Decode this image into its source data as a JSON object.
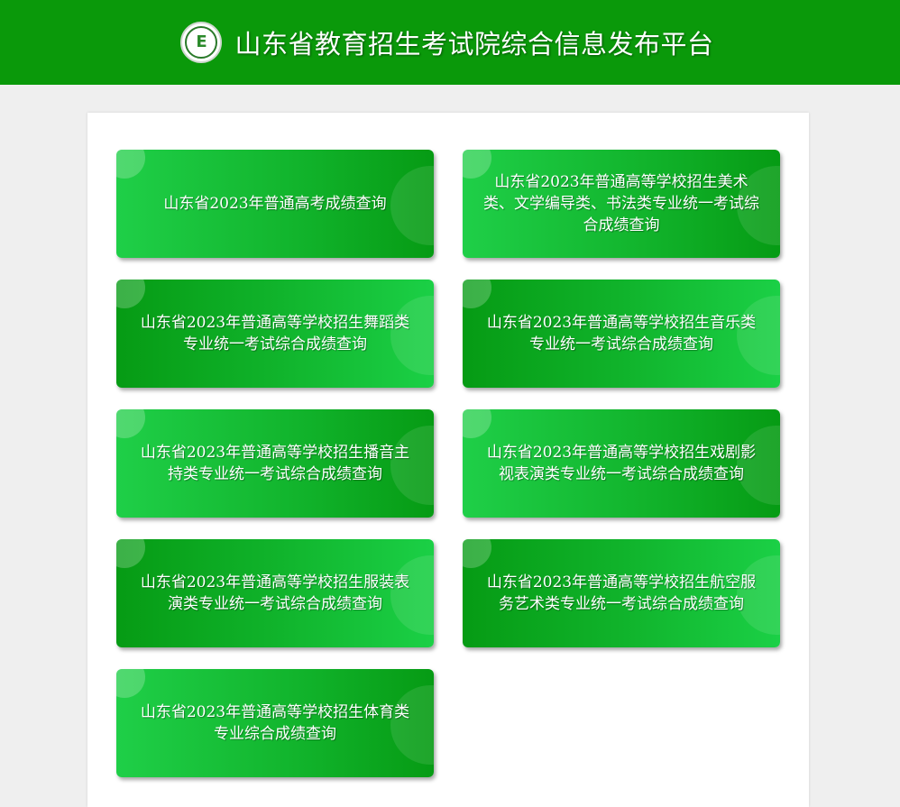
{
  "header": {
    "title": "山东省教育招生考试院综合信息发布平台",
    "logo_icon": "school-emblem-icon",
    "background_color": "#0a990a"
  },
  "cards": [
    {
      "label": "山东省2023年普通高考成绩查询"
    },
    {
      "label": "山东省2023年普通高等学校招生美术类、文学编导类、书法类专业统一考试综合成绩查询"
    },
    {
      "label": "山东省2023年普通高等学校招生舞蹈类专业统一考试综合成绩查询"
    },
    {
      "label": "山东省2023年普通高等学校招生音乐类专业统一考试综合成绩查询"
    },
    {
      "label": "山东省2023年普通高等学校招生播音主持类专业统一考试综合成绩查询"
    },
    {
      "label": "山东省2023年普通高等学校招生戏剧影视表演类专业统一考试综合成绩查询"
    },
    {
      "label": "山东省2023年普通高等学校招生服装表演类专业统一考试综合成绩查询"
    },
    {
      "label": "山东省2023年普通高等学校招生航空服务艺术类专业统一考试综合成绩查询"
    },
    {
      "label": "山东省2023年普通高等学校招生体育类专业综合成绩查询"
    }
  ],
  "colors": {
    "card_light": "#1fcf48",
    "card_dark": "#069b14",
    "page_background": "#efefef"
  }
}
